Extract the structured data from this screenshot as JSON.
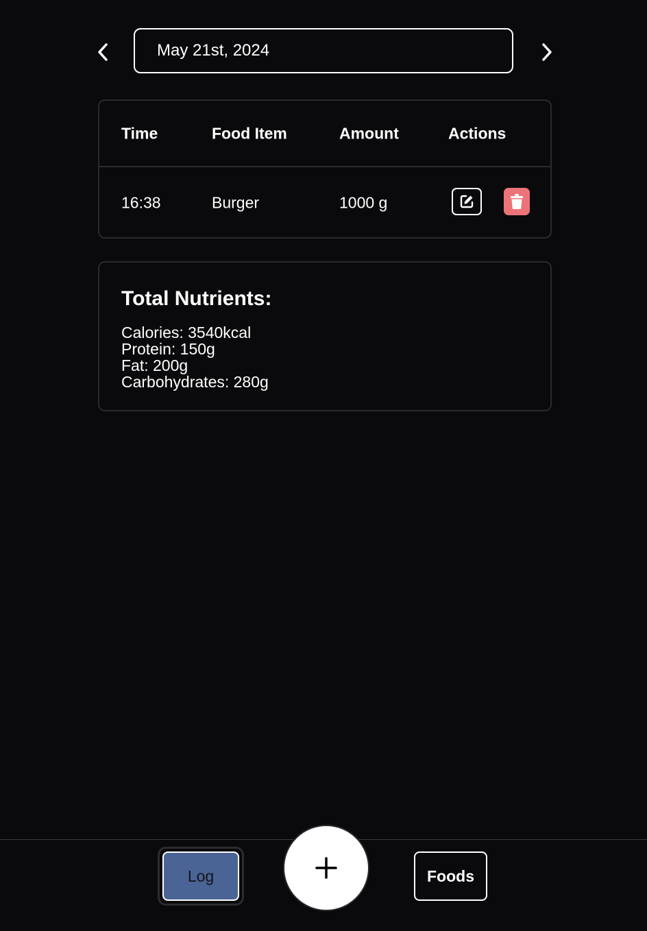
{
  "date_nav": {
    "date": "May 21st, 2024",
    "prev_icon": "chevron-left-icon",
    "next_icon": "chevron-right-icon"
  },
  "log_table": {
    "headers": [
      "Time",
      "Food Item",
      "Amount",
      "Actions"
    ],
    "rows": [
      {
        "time": "16:38",
        "food": "Burger",
        "amount": "1000 g",
        "edit_icon": "edit-icon",
        "delete_icon": "trash-icon"
      }
    ]
  },
  "nutrients": {
    "title": "Total Nutrients:",
    "lines": [
      "Calories: 3540kcal",
      "Protein: 150g",
      "Fat: 200g",
      "Carbohydrates: 280g"
    ]
  },
  "bottom_nav": {
    "log_label": "Log",
    "add_icon": "plus-icon",
    "foods_label": "Foods"
  },
  "colors": {
    "background": "#0a0a0c",
    "delete_button": "#ec7478",
    "active_tab": "#4b6496"
  }
}
